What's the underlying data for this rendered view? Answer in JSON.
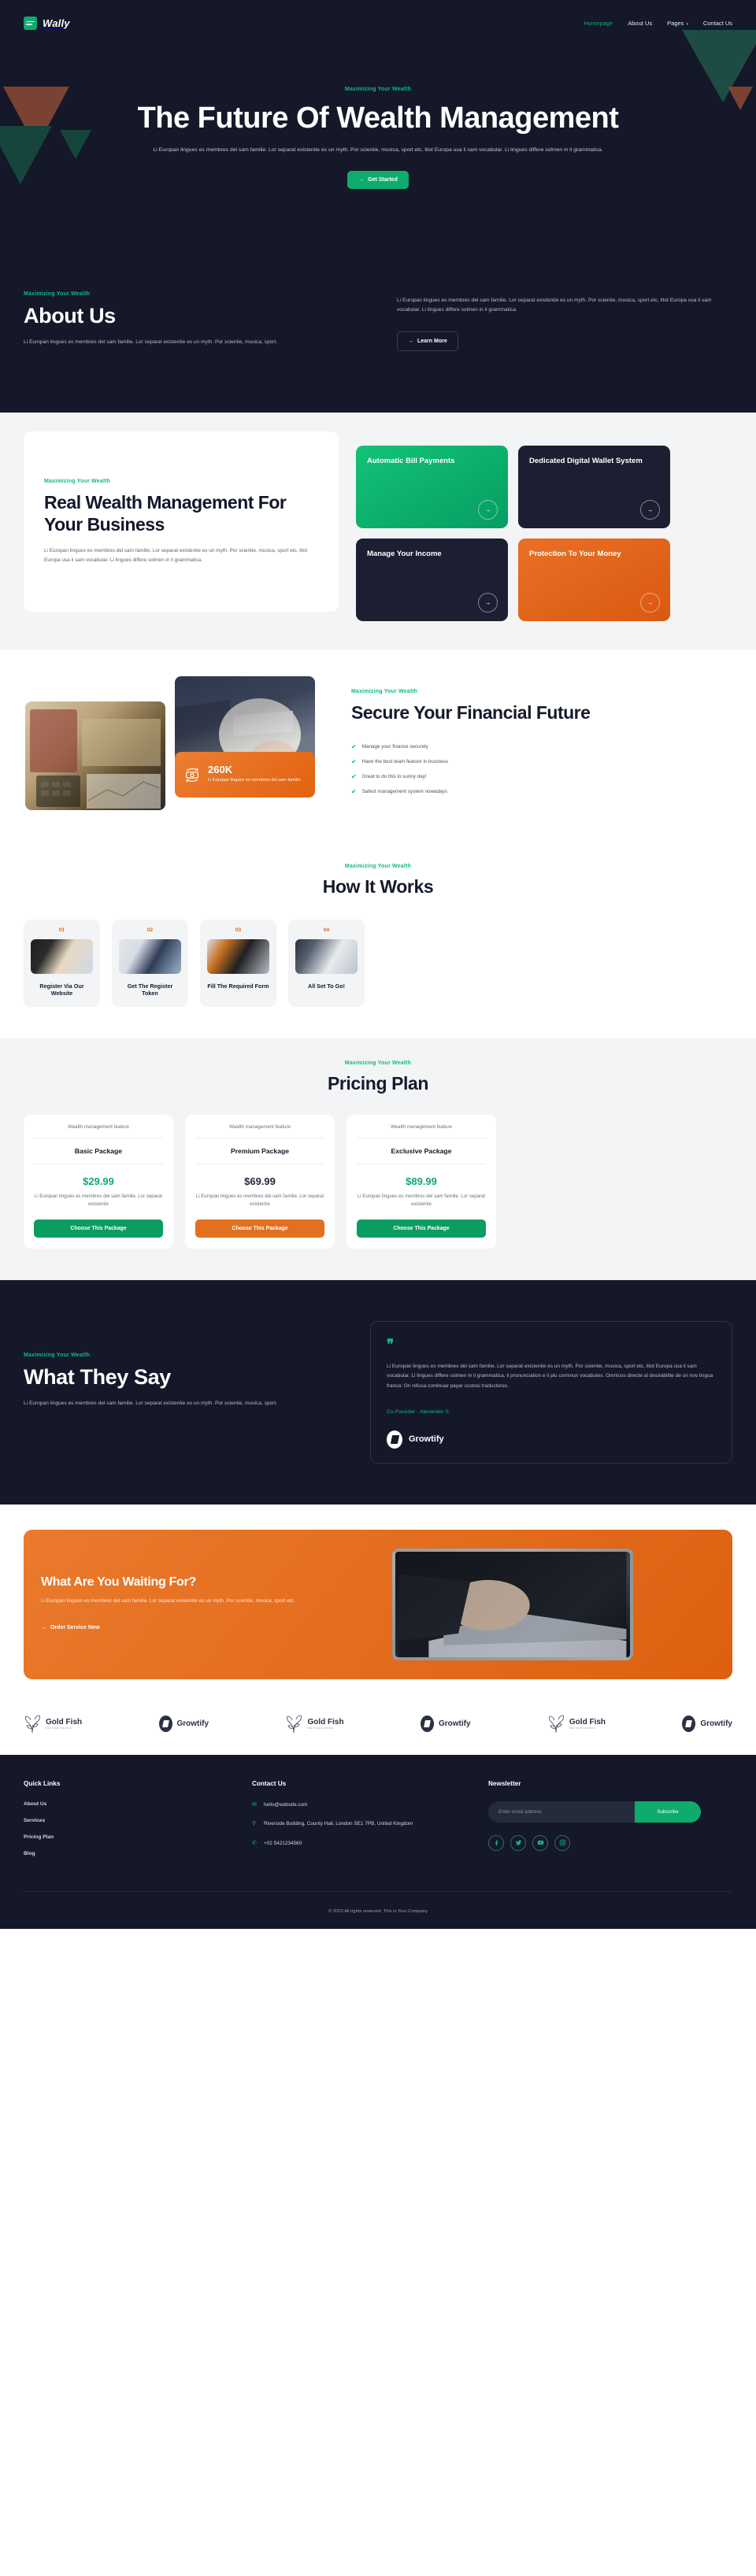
{
  "brand": {
    "name": "Wally",
    "mark_icon": "wallet-icon"
  },
  "nav": {
    "items": [
      {
        "label": "Homepage",
        "active": true
      },
      {
        "label": "About Us",
        "active": false
      },
      {
        "label": "Pages",
        "active": false,
        "caret": "▾"
      },
      {
        "label": "Contact Us",
        "active": false
      }
    ]
  },
  "hero": {
    "eyebrow": "Maximizing Your Wealth",
    "title": "The Future Of Wealth Management",
    "subtitle": "Li Europan lingues es membres del sam familie. Lor separat existentie es un myth. Por scientie, musica, sport etc, litot Europa usa li sam vocabular. Li lingues differe solmen in li grammatica.",
    "cta_label": "Get Started",
    "cta_arrow": "→"
  },
  "about": {
    "eyebrow": "Maximizing Your Wealth",
    "title": "About Us",
    "left_paragraph": "Li Europan lingues es membres del sam familie. Lor separat existentie es un myth. Por scientie, musica, sport.",
    "right_paragraph": "Li Europan lingues es membres del sam familie. Lor separat existentie es un myth. Por scientie, musica, sport etc, litot Europa usa li sam vocabular. Li lingues differe solmen in li grammatica.",
    "button_label": "Learn More",
    "button_arrow": "→"
  },
  "services": {
    "eyebrow": "Maximizing Your Wealth",
    "title": "Real Wealth Management For Your Business",
    "paragraph": "Li Europan lingues es membres del sam familie. Lor separat existentie es un myth. Por scientie, musica, sport etc, litot Europa usa li sam vocabular. Li lingues differe solmen in li grammatica.",
    "cards": [
      {
        "title": "Automatic Bill Payments",
        "style": "green",
        "arrow": "→"
      },
      {
        "title": "Dedicated Digital Wallet System",
        "style": "dark",
        "arrow": "→"
      },
      {
        "title": "Manage Your Income",
        "style": "dark",
        "arrow": "→"
      },
      {
        "title": "Protection To Your Money",
        "style": "orange",
        "arrow": "→"
      }
    ]
  },
  "secure": {
    "eyebrow": "Maximizing Your Wealth",
    "title": "Secure Your Financial Future",
    "stat_value": "260K",
    "stat_text": "Li Europan lingues es membres del sam familie",
    "stat_icon": "money-exchange-icon",
    "checks": [
      "Manage your finance securely",
      "Have the best team feature in business",
      "Great to do this in sunny day!",
      "Safest management system nowadays"
    ],
    "check_icon": "✔"
  },
  "how": {
    "eyebrow": "Maximizing Your Wealth",
    "title": "How It Works",
    "steps": [
      {
        "num": "01",
        "label": "Register Via Our Website"
      },
      {
        "num": "02",
        "label": "Get The Register Token"
      },
      {
        "num": "03",
        "label": "Fill The Required Form"
      },
      {
        "num": "04",
        "label": "All Set To Go!"
      }
    ]
  },
  "pricing": {
    "eyebrow": "Maximizing Your Wealth",
    "title": "Pricing Plan",
    "plans": [
      {
        "feature": "Wealth management feature",
        "name": "Basic Package",
        "price": "$29.99",
        "price_color": "green",
        "desc": "Li Europan lingues es membres del sam familie. Lor separat existentie",
        "button_label": "Choose This Package",
        "button_style": "green"
      },
      {
        "feature": "Wealth management feature",
        "name": "Premium Package",
        "price": "$69.99",
        "price_color": "dark",
        "desc": "Li Europan lingues es membres del sam familie. Lor separat existentie",
        "button_label": "Choose This Package",
        "button_style": "orange"
      },
      {
        "feature": "Wealth management feature",
        "name": "Exclusive Package",
        "price": "$89.99",
        "price_color": "green",
        "desc": "Li Europan lingues es membres del sam familie. Lor separat existentie",
        "button_label": "Choose This Package",
        "button_style": "green"
      }
    ]
  },
  "testimonial": {
    "eyebrow": "Maximizing Your Wealth",
    "title": "What They Say",
    "paragraph": "Li Europan lingues es membres del sam familie. Lor separat existentie es un myth. Por scientie, musica, sport.",
    "quote_mark": "❞",
    "quote": "Li Europan lingues es membres del sam familie. Lor separat existentie es un myth. Por scientie, musica, sport etc, litot Europa usa li sam vocabular. Li lingues differe solmen in li grammatica, li pronunciation e li plu commun vocabules. Omnicos directe al desirabilite de un nov lingua franca: On refusa continuar payar custosi traductores.",
    "author_role": "Co-Founder - ",
    "author_name": "Alexander S.",
    "company": "Growtify"
  },
  "cta": {
    "title": "What Are You Waiting For?",
    "paragraph": "Li Europan lingues es membres del sam familie. Lor separat existentie es un myth. Por scientie, musica, sport etc.",
    "link_label": "Order Service Now",
    "link_arrow": "→"
  },
  "partners": [
    {
      "name": "Gold Fish",
      "sub": "fish food nutrition",
      "type": "goldfish"
    },
    {
      "name": "Growtify",
      "sub": "",
      "type": "growtify"
    },
    {
      "name": "Gold Fish",
      "sub": "fish food nutrition",
      "type": "goldfish"
    },
    {
      "name": "Growtify",
      "sub": "",
      "type": "growtify"
    },
    {
      "name": "Gold Fish",
      "sub": "fish food nutrition",
      "type": "goldfish"
    },
    {
      "name": "Growtify",
      "sub": "",
      "type": "growtify"
    }
  ],
  "footer": {
    "quick_links_title": "Quick Links",
    "quick_links": [
      {
        "label": "About Us"
      },
      {
        "label": "Services"
      },
      {
        "label": "Pricing Plan"
      },
      {
        "label": "Blog"
      }
    ],
    "contact_title": "Contact Us",
    "contact": [
      {
        "icon": "mail-icon",
        "glyph": "✉",
        "text": "hello@website.com"
      },
      {
        "icon": "location-pin-icon",
        "glyph": "⚲",
        "text": "Riverside Building, County Hall, London SE1 7PB, United Kingdom"
      },
      {
        "icon": "phone-icon",
        "glyph": "✆",
        "text": "+02 5421234560"
      }
    ],
    "newsletter_title": "Newsletter",
    "email_placeholder": "Enter email address",
    "email_value": "",
    "subscribe_label": "Subscribe",
    "socials": [
      {
        "name": "facebook-icon",
        "glyph": "f"
      },
      {
        "name": "twitter-icon",
        "glyph": "🐦"
      },
      {
        "name": "youtube-icon",
        "glyph": "▶"
      },
      {
        "name": "instagram-icon",
        "glyph": "◙"
      }
    ],
    "copyright": "© 2023 All rights reserved. This is Your Company"
  },
  "colors": {
    "dark": "#141829",
    "green": "#0eab6d",
    "orange": "#e2620f",
    "grey_bg": "#f3f4f6"
  }
}
